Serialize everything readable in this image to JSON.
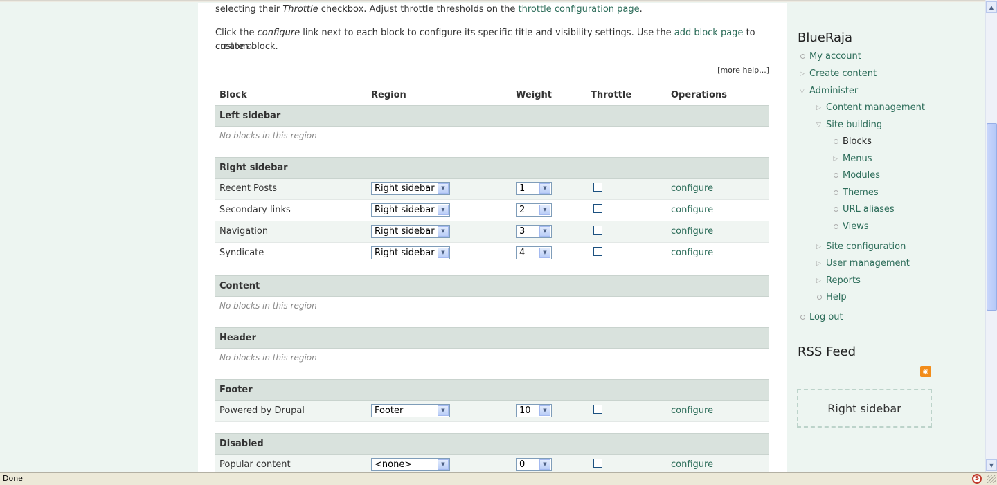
{
  "intro": {
    "line1_a": "selecting their ",
    "line1_em": "Throttle",
    "line1_b": " checkbox. Adjust throttle thresholds on the ",
    "line1_link": "throttle configuration page",
    "line1_c": ".",
    "line2_a": "Click the ",
    "line2_em": "configure",
    "line2_b": " link next to each block to configure its specific title and visibility settings. Use the ",
    "line2_link": "add block page",
    "line2_c": " to create a",
    "line3": "custom block."
  },
  "more_help": "[more help...]",
  "table": {
    "headers": {
      "block": "Block",
      "region": "Region",
      "weight": "Weight",
      "throttle": "Throttle",
      "operations": "Operations"
    },
    "empty_text": "No blocks in this region",
    "configure_label": "configure",
    "regions": {
      "left": "Left sidebar",
      "right": "Right sidebar",
      "content": "Content",
      "header": "Header",
      "footer": "Footer",
      "disabled": "Disabled"
    },
    "rows": [
      {
        "name": "Recent Posts",
        "region": "Right sidebar",
        "weight": "1"
      },
      {
        "name": "Secondary links",
        "region": "Right sidebar",
        "weight": "2"
      },
      {
        "name": "Navigation",
        "region": "Right sidebar",
        "weight": "3"
      },
      {
        "name": "Syndicate",
        "region": "Right sidebar",
        "weight": "4"
      },
      {
        "name": "Powered by Drupal",
        "region": "Footer",
        "weight": "10"
      },
      {
        "name": "Popular content",
        "region": "<none>",
        "weight": "0"
      }
    ]
  },
  "sidebar": {
    "user_title": "BlueRaja",
    "menu": {
      "my_account": "My account",
      "create_content": "Create content",
      "administer": "Administer",
      "content_management": "Content management",
      "site_building": "Site building",
      "blocks": "Blocks",
      "menus": "Menus",
      "modules": "Modules",
      "themes": "Themes",
      "url_aliases": "URL aliases",
      "views": "Views",
      "site_configuration": "Site configuration",
      "user_management": "User management",
      "reports": "Reports",
      "help": "Help",
      "log_out": "Log out"
    },
    "rss_title": "RSS Feed",
    "region_box": "Right sidebar"
  },
  "status": {
    "text": "Done"
  },
  "icons": {
    "collapsed": "triangle-right-icon",
    "expanded": "triangle-down-icon",
    "leaf": "circle-icon",
    "rss": "rss-feed-icon",
    "status": "security-shield-icon"
  },
  "colors": {
    "link": "#2d6d5a",
    "region_header_bg": "#d9e2dd",
    "page_bg": "#edf5f1",
    "accent_rss": "#f28c1a"
  }
}
